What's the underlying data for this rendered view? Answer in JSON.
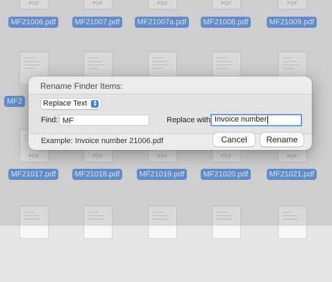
{
  "files": {
    "row1": [
      "MF21006.pdf",
      "MF21007.pdf",
      "MF21007a.pdf",
      "MF21008.pdf",
      "MF21009.pdf"
    ],
    "row2_left_partial": "MF2",
    "row3": [
      "MF21017.pdf",
      "MF21018.pdf",
      "MF21019.pdf",
      "MF21020.pdf",
      "MF21021.pdf"
    ],
    "pdf_label": "PDF"
  },
  "dialog": {
    "title": "Rename Finder Items:",
    "mode": "Replace Text",
    "find_label": "Find:",
    "find_value": "MF",
    "replace_label": "Replace with:",
    "replace_value": "Invoice number",
    "example": "Example: Invoice number 21006.pdf",
    "cancel": "Cancel",
    "rename": "Rename"
  },
  "colors": {
    "selection": "#3b82e6",
    "focus_ring": "#6b9ee8"
  }
}
